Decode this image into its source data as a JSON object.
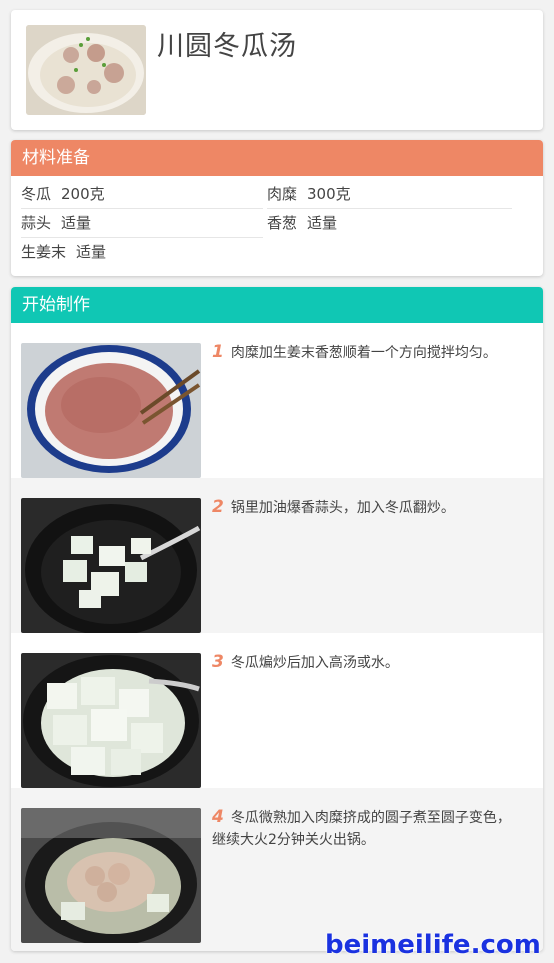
{
  "recipe": {
    "title": "川圆冬瓜汤"
  },
  "ingredients": {
    "heading": "材料准备",
    "items": [
      {
        "name": "冬瓜",
        "amount": "200克"
      },
      {
        "name": "肉糜",
        "amount": "300克"
      },
      {
        "name": "蒜头",
        "amount": "适量"
      },
      {
        "name": "香葱",
        "amount": "适量"
      },
      {
        "name": "生姜末",
        "amount": "适量"
      }
    ]
  },
  "steps": {
    "heading": "开始制作",
    "items": [
      {
        "num": "1",
        "text": "肉糜加生姜末香葱顺着一个方向搅拌均匀。"
      },
      {
        "num": "2",
        "text": "锅里加油爆香蒜头，加入冬瓜翻炒。"
      },
      {
        "num": "3",
        "text": "冬瓜煸炒后加入高汤或水。"
      },
      {
        "num": "4",
        "text": "冬瓜微熟加入肉糜挤成的圆子煮至圆子变色，继续大火2分钟关火出锅。"
      }
    ]
  },
  "watermark": "beimeilife.com"
}
